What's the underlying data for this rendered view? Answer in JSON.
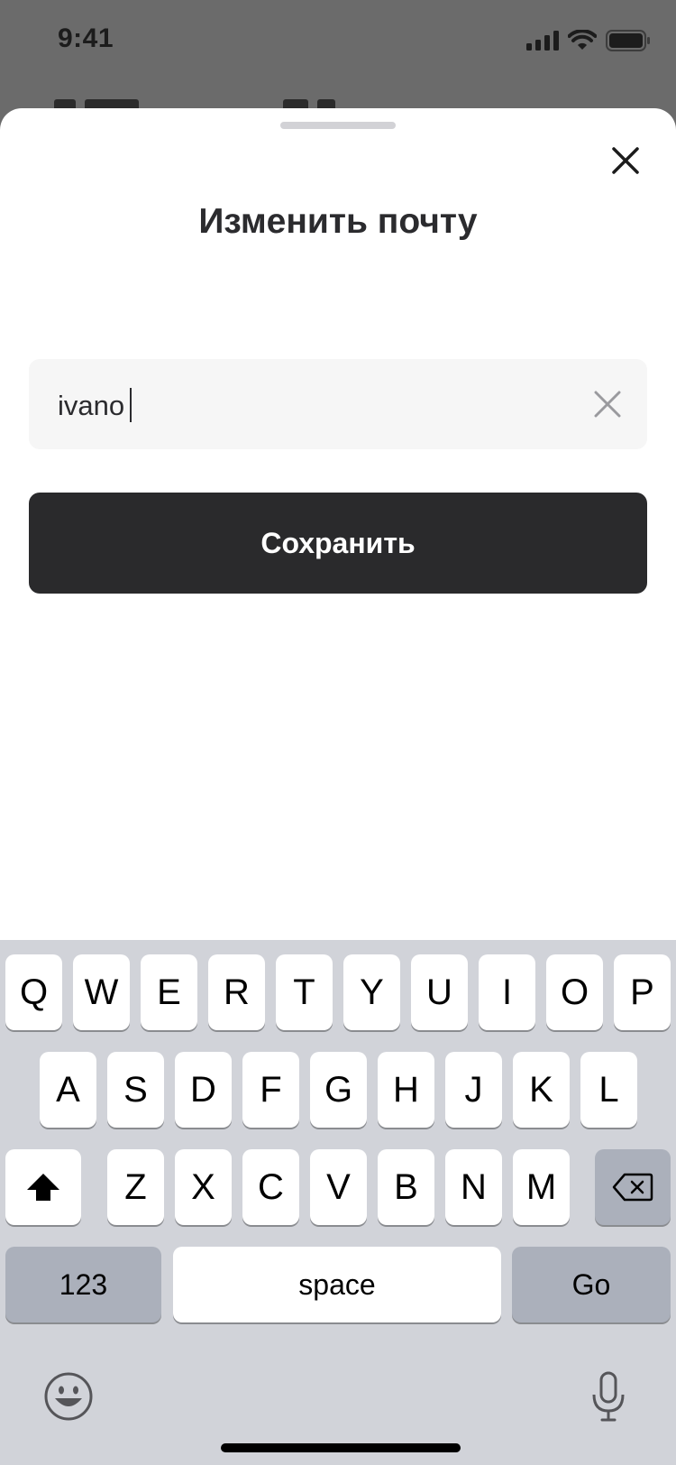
{
  "status_bar": {
    "time": "9:41"
  },
  "sheet": {
    "title": "Изменить почту",
    "email_value": "ivano",
    "save_label": "Сохранить"
  },
  "keyboard": {
    "row1": [
      "Q",
      "W",
      "E",
      "R",
      "T",
      "Y",
      "U",
      "I",
      "O",
      "P"
    ],
    "row2": [
      "A",
      "S",
      "D",
      "F",
      "G",
      "H",
      "J",
      "K",
      "L"
    ],
    "row3": [
      "Z",
      "X",
      "C",
      "V",
      "B",
      "N",
      "M"
    ],
    "numbers_label": "123",
    "space_label": "space",
    "go_label": "Go"
  },
  "icons": {
    "close": "close-icon",
    "clear": "clear-icon",
    "shift": "shift-icon",
    "backspace": "backspace-icon",
    "emoji": "emoji-icon",
    "microphone": "microphone-icon",
    "signal": "cellular-signal-icon",
    "wifi": "wifi-icon",
    "battery": "battery-icon"
  },
  "colors": {
    "backdrop": "#6b6b6b",
    "button": "#2a2a2c",
    "keyboard_bg": "#d1d3d9",
    "special_key": "#abb0bb"
  }
}
